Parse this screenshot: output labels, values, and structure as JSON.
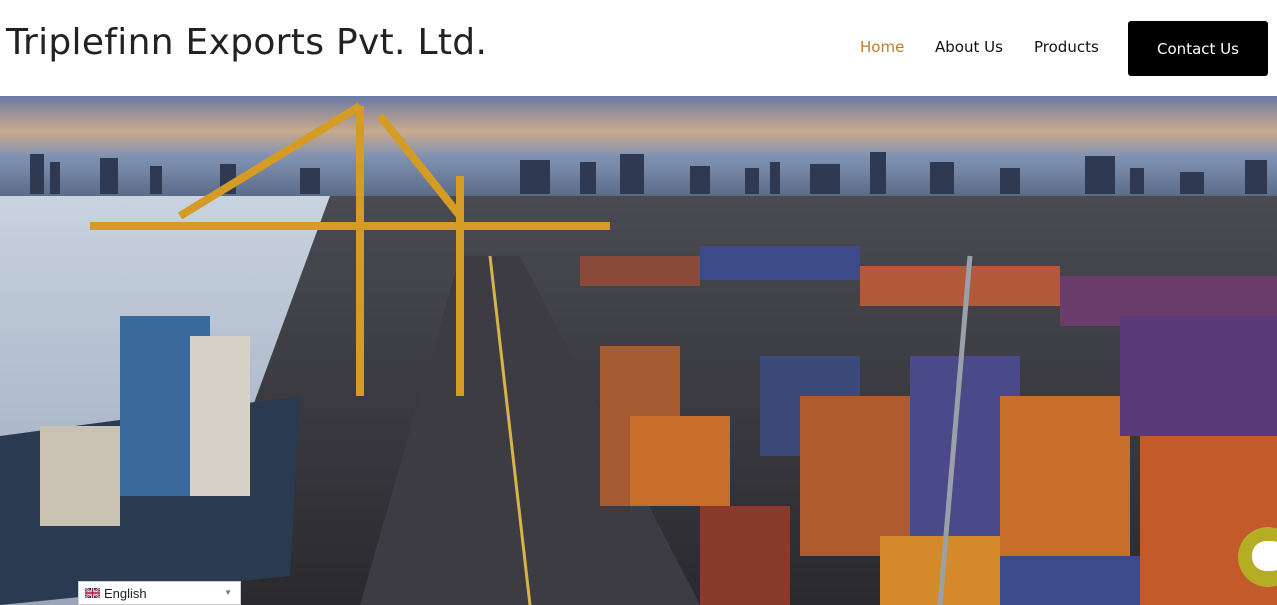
{
  "header": {
    "site_title": "Triplefinn Exports Pvt. Ltd.",
    "nav": {
      "home": "Home",
      "about": "About Us",
      "products": "Products",
      "contact": "Contact Us"
    }
  },
  "language": {
    "selected": "English",
    "flag_icon": "uk-flag-icon"
  },
  "colors": {
    "active_nav": "#c27a2c",
    "contact_button_bg": "#000000",
    "chat_bubble": "#b5ad24"
  }
}
